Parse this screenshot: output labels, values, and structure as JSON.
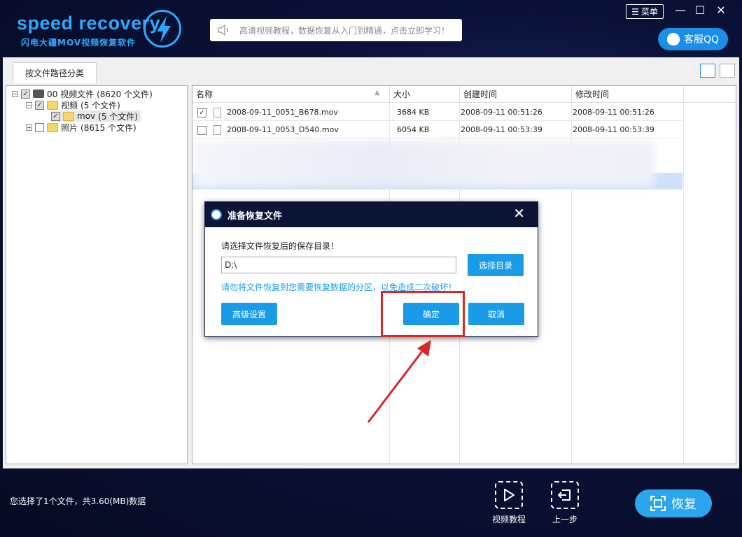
{
  "header": {
    "logo_text": "speed recovery",
    "logo_subtitle": "闪电大疆MOV视频恢复软件",
    "notice": "高清视频教程，数据恢复从入门到精通，点击立即学习！",
    "menu_label": "菜单",
    "qq_label": "客服QQ"
  },
  "tabs": [
    {
      "label": "按文件路径分类"
    }
  ],
  "tree": [
    {
      "label": "00 视频文件",
      "count": "(8620 个文件)"
    },
    {
      "label": "视频",
      "count": "(5 个文件)"
    },
    {
      "label": "mov",
      "count": "(5 个文件)"
    },
    {
      "label": "照片",
      "count": "(8615 个文件)"
    }
  ],
  "columns": [
    "名称",
    "大小",
    "创建时间",
    "修改时间"
  ],
  "files": [
    {
      "name": "2008-09-11_0051_B678.mov",
      "size": "3684 KB",
      "created": "2008-09-11  00:51:26",
      "modified": "2008-09-11  00:51:26",
      "checked": "✓"
    },
    {
      "name": "2008-09-11_0053_D540.mov",
      "size": "6054 KB",
      "created": "2008-09-11  00:53:39",
      "modified": "2008-09-11  00:53:39",
      "checked": ""
    }
  ],
  "dialog": {
    "title": "准备恢复文件",
    "prompt": "请选择文件恢复后的保存目录！",
    "path_value": "D:\\",
    "choose_dir": "选择目录",
    "warning": "请勿将文件恢复到您需要恢复数据的分区，以免造成二次破坏！",
    "advanced": "高级设置",
    "ok": "确定",
    "cancel": "取消"
  },
  "footer": {
    "status": "您选择了1个文件，共3.60(MB)数据",
    "video_tutorial": "视频教程",
    "back": "上一步",
    "restore": "恢复"
  },
  "colors": {
    "accent": "#1a9be8",
    "highlight": "#d8262a",
    "dark_bg": "#0d1537"
  }
}
